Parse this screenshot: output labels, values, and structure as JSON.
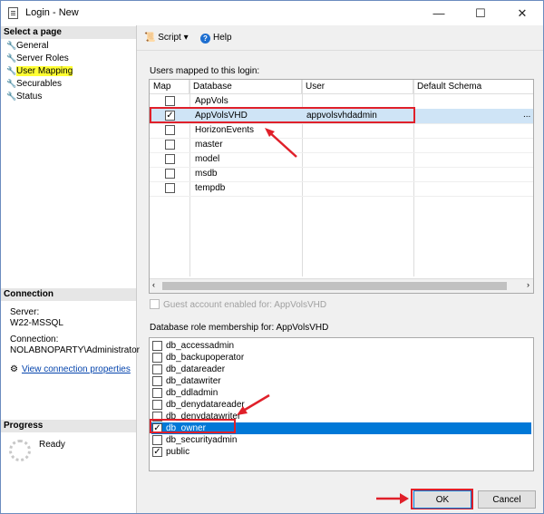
{
  "window": {
    "title": "Login - New",
    "minimize": "—",
    "maximize": "☐",
    "close": "✕"
  },
  "left": {
    "select_heading": "Select a page",
    "pages": [
      "General",
      "Server Roles",
      "User Mapping",
      "Securables",
      "Status"
    ],
    "connection_heading": "Connection",
    "server_label": "Server:",
    "server_value": "W22-MSSQL",
    "connection_label": "Connection:",
    "connection_value": "NOLABNOPARTY\\Administrator",
    "view_link": "View connection properties",
    "progress_heading": "Progress",
    "progress_status": "Ready"
  },
  "toolbar": {
    "script": "Script",
    "help": "Help"
  },
  "users_label": "Users mapped to this login:",
  "grid": {
    "columns": [
      "Map",
      "Database",
      "User",
      "Default Schema"
    ],
    "rows": [
      {
        "checked": false,
        "database": "AppVols",
        "user": "",
        "schema": ""
      },
      {
        "checked": true,
        "database": "AppVolsVHD",
        "user": "appvolsvhdadmin",
        "schema": ""
      },
      {
        "checked": false,
        "database": "HorizonEvents",
        "user": "",
        "schema": ""
      },
      {
        "checked": false,
        "database": "master",
        "user": "",
        "schema": ""
      },
      {
        "checked": false,
        "database": "model",
        "user": "",
        "schema": ""
      },
      {
        "checked": false,
        "database": "msdb",
        "user": "",
        "schema": ""
      },
      {
        "checked": false,
        "database": "tempdb",
        "user": "",
        "schema": ""
      }
    ],
    "ellipsis": "..."
  },
  "guest_label": "Guest account enabled for: AppVolsVHD",
  "roles_label": "Database role membership for: AppVolsVHD",
  "roles": [
    {
      "name": "db_accessadmin",
      "checked": false
    },
    {
      "name": "db_backupoperator",
      "checked": false
    },
    {
      "name": "db_datareader",
      "checked": false
    },
    {
      "name": "db_datawriter",
      "checked": false
    },
    {
      "name": "db_ddladmin",
      "checked": false
    },
    {
      "name": "db_denydatareader",
      "checked": false
    },
    {
      "name": "db_denydatawriter",
      "checked": false
    },
    {
      "name": "db_owner",
      "checked": true
    },
    {
      "name": "db_securityadmin",
      "checked": false
    },
    {
      "name": "public",
      "checked": true
    }
  ],
  "buttons": {
    "ok": "OK",
    "cancel": "Cancel"
  },
  "colors": {
    "highlight": "#ffff33",
    "selection": "#0078d7",
    "annotation": "#e0202a"
  }
}
